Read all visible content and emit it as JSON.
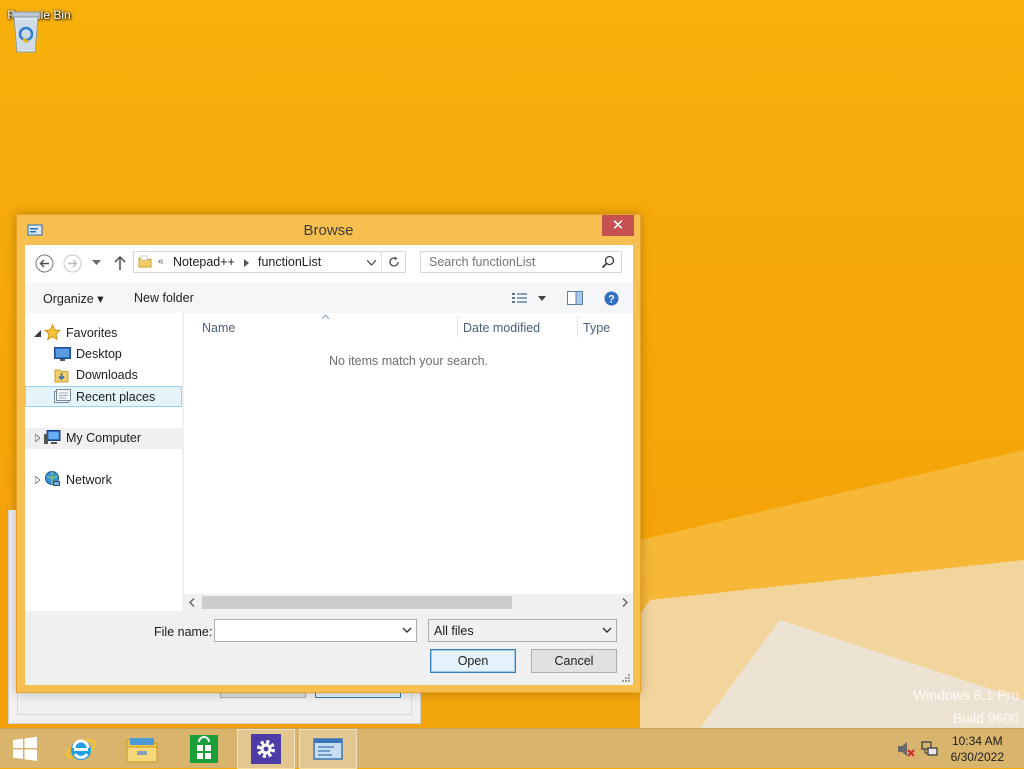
{
  "desktop": {
    "icons": [
      {
        "label": "Recycle Bin",
        "icon": "recycle-bin-icon"
      }
    ],
    "watermark": {
      "line1": "Windows 8.1 Pro",
      "line2": "Build 9600"
    }
  },
  "dialog": {
    "title": "Browse",
    "close_label": "✕",
    "address": {
      "overflow": "«",
      "segments": [
        "Notepad++",
        "functionList"
      ]
    },
    "search": {
      "placeholder": "Search functionList"
    },
    "commands": {
      "organize": "Organize ▾",
      "new_folder": "New folder"
    },
    "nav_tree": {
      "favorites": "Favorites",
      "desktop": "Desktop",
      "downloads": "Downloads",
      "recent": "Recent places",
      "computer": "My Computer",
      "network": "Network"
    },
    "columns": [
      "Name",
      "Date modified",
      "Type"
    ],
    "empty_message": "No items match your search.",
    "file_name_label": "File name:",
    "file_name_value": "",
    "filter_value": "All files",
    "open_label": "Open",
    "cancel_label": "Cancel"
  },
  "taskbar": {
    "items": [
      "start-button",
      "internet-explorer",
      "file-explorer",
      "store",
      "settings",
      "browse-window"
    ],
    "clock": {
      "time": "10:34 AM",
      "date": "6/30/2022"
    }
  },
  "colors": {
    "desktop": "#f5a608",
    "dialog_frame": "#f7bf4f",
    "close": "#c75050",
    "taskbar": "#d8b46c"
  }
}
